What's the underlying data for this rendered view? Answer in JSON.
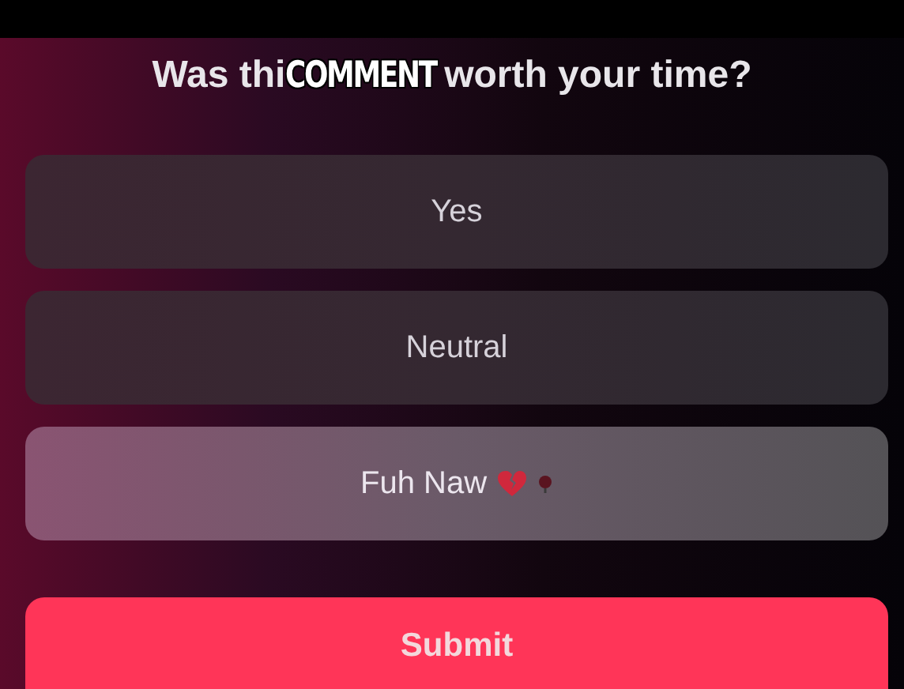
{
  "title": {
    "before": "Was thi",
    "after": "worth your time?"
  },
  "caption": "COMMENT",
  "options": [
    {
      "label": "Yes",
      "kind": "plain",
      "selected": false
    },
    {
      "label": "Neutral",
      "kind": "plain",
      "selected": false
    },
    {
      "label": "Fuh Naw",
      "kind": "heart",
      "selected": true
    }
  ],
  "submit": "Submit"
}
